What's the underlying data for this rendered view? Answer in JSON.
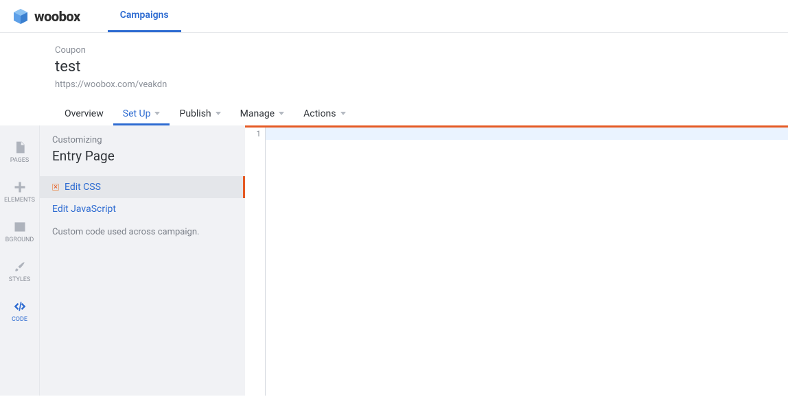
{
  "brand": {
    "name": "woobox"
  },
  "topnav": {
    "campaigns": "Campaigns"
  },
  "campaign": {
    "type": "Coupon",
    "title": "test",
    "url": "https://woobox.com/veakdn"
  },
  "subtabs": {
    "overview": "Overview",
    "setup": "Set Up",
    "publish": "Publish",
    "manage": "Manage",
    "actions": "Actions"
  },
  "rail": {
    "pages": "PAGES",
    "elements": "ELEMENTS",
    "bground": "BGROUND",
    "styles": "STYLES",
    "code": "CODE"
  },
  "customize": {
    "sub": "Customizing",
    "title": "Entry Page",
    "edit_css": "Edit CSS",
    "edit_js": "Edit JavaScript",
    "note": "Custom code used across campaign."
  },
  "editor": {
    "line_number": "1"
  }
}
